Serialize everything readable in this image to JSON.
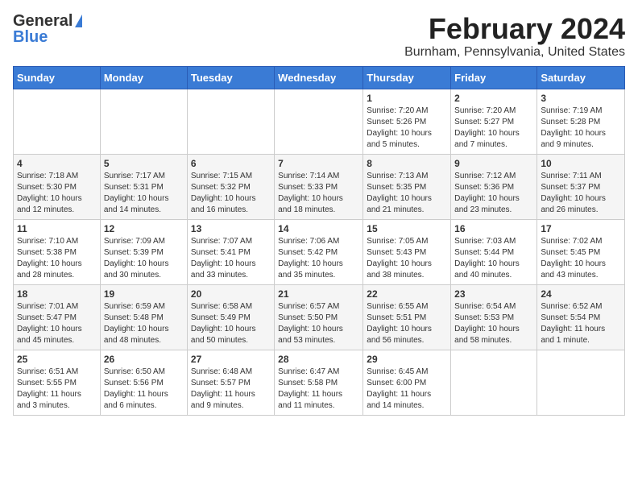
{
  "header": {
    "logo_general": "General",
    "logo_blue": "Blue",
    "month_title": "February 2024",
    "location": "Burnham, Pennsylvania, United States"
  },
  "weekdays": [
    "Sunday",
    "Monday",
    "Tuesday",
    "Wednesday",
    "Thursday",
    "Friday",
    "Saturday"
  ],
  "weeks": [
    [
      {
        "day": "",
        "info": ""
      },
      {
        "day": "",
        "info": ""
      },
      {
        "day": "",
        "info": ""
      },
      {
        "day": "",
        "info": ""
      },
      {
        "day": "1",
        "info": "Sunrise: 7:20 AM\nSunset: 5:26 PM\nDaylight: 10 hours\nand 5 minutes."
      },
      {
        "day": "2",
        "info": "Sunrise: 7:20 AM\nSunset: 5:27 PM\nDaylight: 10 hours\nand 7 minutes."
      },
      {
        "day": "3",
        "info": "Sunrise: 7:19 AM\nSunset: 5:28 PM\nDaylight: 10 hours\nand 9 minutes."
      }
    ],
    [
      {
        "day": "4",
        "info": "Sunrise: 7:18 AM\nSunset: 5:30 PM\nDaylight: 10 hours\nand 12 minutes."
      },
      {
        "day": "5",
        "info": "Sunrise: 7:17 AM\nSunset: 5:31 PM\nDaylight: 10 hours\nand 14 minutes."
      },
      {
        "day": "6",
        "info": "Sunrise: 7:15 AM\nSunset: 5:32 PM\nDaylight: 10 hours\nand 16 minutes."
      },
      {
        "day": "7",
        "info": "Sunrise: 7:14 AM\nSunset: 5:33 PM\nDaylight: 10 hours\nand 18 minutes."
      },
      {
        "day": "8",
        "info": "Sunrise: 7:13 AM\nSunset: 5:35 PM\nDaylight: 10 hours\nand 21 minutes."
      },
      {
        "day": "9",
        "info": "Sunrise: 7:12 AM\nSunset: 5:36 PM\nDaylight: 10 hours\nand 23 minutes."
      },
      {
        "day": "10",
        "info": "Sunrise: 7:11 AM\nSunset: 5:37 PM\nDaylight: 10 hours\nand 26 minutes."
      }
    ],
    [
      {
        "day": "11",
        "info": "Sunrise: 7:10 AM\nSunset: 5:38 PM\nDaylight: 10 hours\nand 28 minutes."
      },
      {
        "day": "12",
        "info": "Sunrise: 7:09 AM\nSunset: 5:39 PM\nDaylight: 10 hours\nand 30 minutes."
      },
      {
        "day": "13",
        "info": "Sunrise: 7:07 AM\nSunset: 5:41 PM\nDaylight: 10 hours\nand 33 minutes."
      },
      {
        "day": "14",
        "info": "Sunrise: 7:06 AM\nSunset: 5:42 PM\nDaylight: 10 hours\nand 35 minutes."
      },
      {
        "day": "15",
        "info": "Sunrise: 7:05 AM\nSunset: 5:43 PM\nDaylight: 10 hours\nand 38 minutes."
      },
      {
        "day": "16",
        "info": "Sunrise: 7:03 AM\nSunset: 5:44 PM\nDaylight: 10 hours\nand 40 minutes."
      },
      {
        "day": "17",
        "info": "Sunrise: 7:02 AM\nSunset: 5:45 PM\nDaylight: 10 hours\nand 43 minutes."
      }
    ],
    [
      {
        "day": "18",
        "info": "Sunrise: 7:01 AM\nSunset: 5:47 PM\nDaylight: 10 hours\nand 45 minutes."
      },
      {
        "day": "19",
        "info": "Sunrise: 6:59 AM\nSunset: 5:48 PM\nDaylight: 10 hours\nand 48 minutes."
      },
      {
        "day": "20",
        "info": "Sunrise: 6:58 AM\nSunset: 5:49 PM\nDaylight: 10 hours\nand 50 minutes."
      },
      {
        "day": "21",
        "info": "Sunrise: 6:57 AM\nSunset: 5:50 PM\nDaylight: 10 hours\nand 53 minutes."
      },
      {
        "day": "22",
        "info": "Sunrise: 6:55 AM\nSunset: 5:51 PM\nDaylight: 10 hours\nand 56 minutes."
      },
      {
        "day": "23",
        "info": "Sunrise: 6:54 AM\nSunset: 5:53 PM\nDaylight: 10 hours\nand 58 minutes."
      },
      {
        "day": "24",
        "info": "Sunrise: 6:52 AM\nSunset: 5:54 PM\nDaylight: 11 hours\nand 1 minute."
      }
    ],
    [
      {
        "day": "25",
        "info": "Sunrise: 6:51 AM\nSunset: 5:55 PM\nDaylight: 11 hours\nand 3 minutes."
      },
      {
        "day": "26",
        "info": "Sunrise: 6:50 AM\nSunset: 5:56 PM\nDaylight: 11 hours\nand 6 minutes."
      },
      {
        "day": "27",
        "info": "Sunrise: 6:48 AM\nSunset: 5:57 PM\nDaylight: 11 hours\nand 9 minutes."
      },
      {
        "day": "28",
        "info": "Sunrise: 6:47 AM\nSunset: 5:58 PM\nDaylight: 11 hours\nand 11 minutes."
      },
      {
        "day": "29",
        "info": "Sunrise: 6:45 AM\nSunset: 6:00 PM\nDaylight: 11 hours\nand 14 minutes."
      },
      {
        "day": "",
        "info": ""
      },
      {
        "day": "",
        "info": ""
      }
    ]
  ]
}
